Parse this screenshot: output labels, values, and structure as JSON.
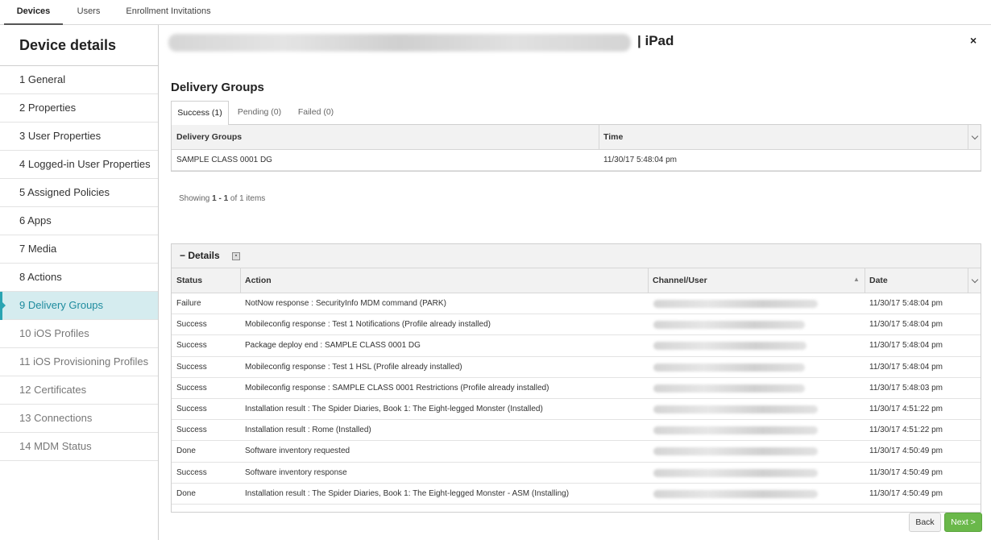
{
  "topnav": {
    "tabs": [
      {
        "label": "Devices"
      },
      {
        "label": "Users"
      },
      {
        "label": "Enrollment Invitations"
      }
    ]
  },
  "sidebar": {
    "title": "Device details",
    "items": [
      {
        "label": "1  General"
      },
      {
        "label": "2  Properties"
      },
      {
        "label": "3  User Properties"
      },
      {
        "label": "4  Logged-in User Properties"
      },
      {
        "label": "5  Assigned Policies"
      },
      {
        "label": "6  Apps"
      },
      {
        "label": "7  Media"
      },
      {
        "label": "8  Actions"
      },
      {
        "label": "9  Delivery Groups"
      },
      {
        "label": "10  iOS Profiles"
      },
      {
        "label": "11  iOS Provisioning Profiles"
      },
      {
        "label": "12  Certificates"
      },
      {
        "label": "13  Connections"
      },
      {
        "label": "14  MDM Status"
      }
    ]
  },
  "header": {
    "device_type": "| iPad",
    "close_glyph": "×"
  },
  "delivery_groups": {
    "title": "Delivery Groups",
    "tabs": [
      {
        "label": "Success (1)"
      },
      {
        "label": "Pending (0)"
      },
      {
        "label": "Failed (0)"
      }
    ],
    "columns": [
      "Delivery Groups",
      "Time"
    ],
    "rows": [
      {
        "group": "SAMPLE CLASS 0001 DG",
        "time": "11/30/17 5:48:04 pm"
      }
    ],
    "showing": {
      "prefix": "Showing ",
      "range": "1 - 1",
      "of": " of ",
      "total": "1",
      "suffix": " items"
    }
  },
  "details": {
    "toggle_label": "− Details",
    "columns": [
      "Status",
      "Action",
      "Channel/User",
      "Date"
    ],
    "rows": [
      {
        "status": "Failure",
        "action": "NotNow response : SecurityInfo MDM command (PARK)",
        "date": "11/30/17 5:48:04 pm"
      },
      {
        "status": "Success",
        "action": "Mobileconfig response : Test 1 Notifications (Profile already installed)",
        "date": "11/30/17 5:48:04 pm"
      },
      {
        "status": "Success",
        "action": "Package deploy end : SAMPLE CLASS 0001 DG",
        "date": "11/30/17 5:48:04 pm"
      },
      {
        "status": "Success",
        "action": "Mobileconfig response : Test 1 HSL (Profile already installed)",
        "date": "11/30/17 5:48:04 pm"
      },
      {
        "status": "Success",
        "action": "Mobileconfig response : SAMPLE CLASS 0001 Restrictions (Profile already installed)",
        "date": "11/30/17 5:48:03 pm"
      },
      {
        "status": "Success",
        "action": "Installation result : The Spider Diaries, Book 1: The Eight-legged Monster (Installed)",
        "date": "11/30/17 4:51:22 pm"
      },
      {
        "status": "Success",
        "action": "Installation result : Rome (Installed)",
        "date": "11/30/17 4:51:22 pm"
      },
      {
        "status": "Done",
        "action": "Software inventory requested",
        "date": "11/30/17 4:50:49 pm"
      },
      {
        "status": "Success",
        "action": "Software inventory response",
        "date": "11/30/17 4:50:49 pm"
      },
      {
        "status": "Done",
        "action": "Installation result : The Spider Diaries, Book 1: The Eight-legged Monster - ASM (Installing)",
        "date": "11/30/17 4:50:49 pm"
      }
    ]
  },
  "buttons": {
    "back": "Back",
    "next": "Next >"
  },
  "colors": {
    "active_nav_bg": "#d5ecef",
    "active_nav_text": "#1d8b9e",
    "next_button": "#6ab84a"
  }
}
